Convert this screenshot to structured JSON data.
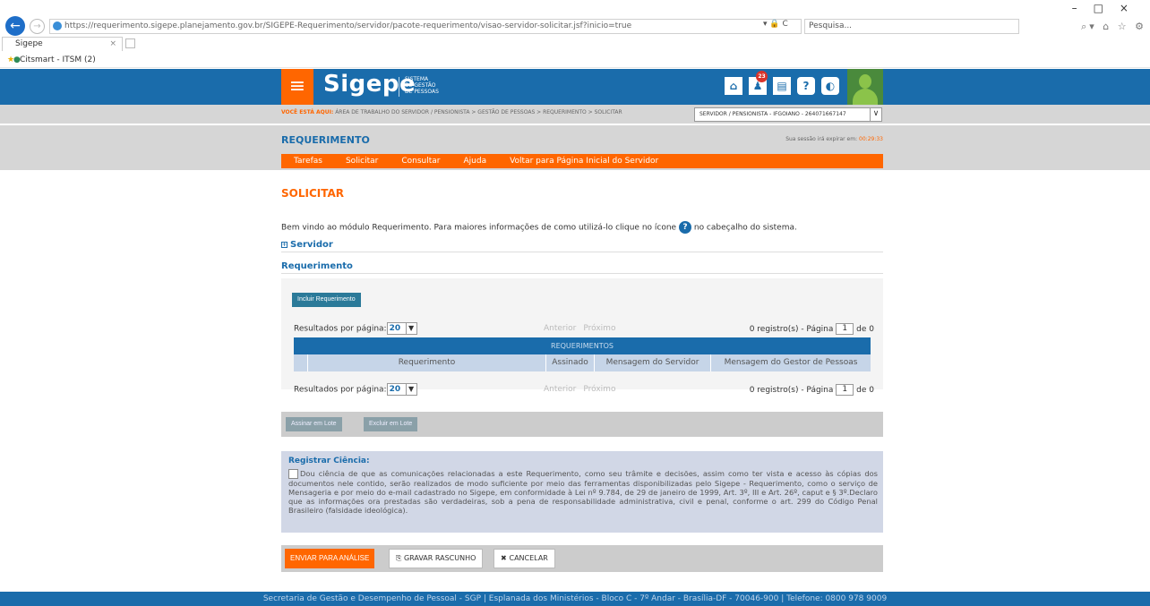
{
  "browser": {
    "url": "https://requerimento.sigepe.planejamento.gov.br/SIGEPE-Requerimento/servidor/pacote-requerimento/visao-servidor-solicitar.jsf?inicio=true",
    "search_placeholder": "Pesquisa...",
    "tab_title": "Sigepe",
    "favorite_label": "Citsmart - ITSM (2)",
    "url_tools": "▾ 🔒 C",
    "window_controls": "–□×",
    "right_icons": "⌕▾ ⌂ ☆ ⚙"
  },
  "header": {
    "logo": "Sigepe",
    "logo_sub_1": "SISTEMA",
    "logo_sub_2": "DE GESTÃO",
    "logo_sub_3": "DE PESSOAS",
    "notification_count": "23",
    "menu_icon": "≡",
    "home_icon": "⌂",
    "bell_icon": "♟",
    "book_icon": "▤",
    "help_icon": "?",
    "contrast_icon": "◐"
  },
  "breadcrumb": {
    "here_label": "VOCÊ ESTÁ AQUI:",
    "path": "ÁREA DE TRABALHO DO SERVIDOR / PENSIONISTA  >  GESTÃO DE PESSOAS  >  REQUERIMENTO  >  SOLICITAR",
    "profile": "SERVIDOR / PENSIONISTA - IFGOIANO - 264071667147",
    "profile_arrow": "∨"
  },
  "title_bar": {
    "title": "REQUERIMENTO",
    "session_label": "Sua sessão irá expirar em:",
    "session_time": "00:29:33"
  },
  "nav": {
    "items": [
      "Tarefas",
      "Solicitar",
      "Consultar",
      "Ajuda",
      "Voltar para Página Inicial do Servidor"
    ]
  },
  "main": {
    "heading": "SOLICITAR",
    "welcome_before": "Bem vindo ao módulo Requerimento. Para maiores informações de como utilizá-lo clique no ícone",
    "welcome_after": "no cabeçalho do sistema.",
    "servidor_label": "Servidor",
    "requerimento_label": "Requerimento",
    "incluir_button": "Incluir Requerimento",
    "per_page_label": "Resultados por página:",
    "per_page_value": "20",
    "prev": "Anterior",
    "next": "Próximo",
    "records_label": "0 registro(s) - Página",
    "page_value": "1",
    "of_label": "de 0",
    "table_title": "REQUERIMENTOS",
    "columns": [
      "Requerimento",
      "Assinado",
      "Mensagem do Servidor",
      "Mensagem do Gestor de Pessoas"
    ],
    "assinar_lote": "Assinar em Lote",
    "excluir_lote": "Excluir em Lote",
    "ciencia_title": "Registrar Ciência:",
    "ciencia_text": "Dou ciência de que as comunicações relacionadas a este Requerimento, como seu trâmite e decisões, assim como ter vista e acesso às cópias dos documentos nele contido, serão realizados de modo suficiente por meio das ferramentas disponibilizadas pelo Sigepe - Requerimento, como o serviço de Mensageria e por meio do e-mail cadastrado no Sigepe, em conformidade à Lei nº 9.784, de 29 de janeiro de 1999, Art. 3º, III e Art. 26º, caput e § 3º.Declaro que as informações ora prestadas são verdadeiras, sob a pena de responsabilidade administrativa, civil e penal, conforme o art. 299 do Código Penal Brasileiro (falsidade ideológica).",
    "enviar_button": "ENVIAR PARA ANÁLISE",
    "rascunho_button": "GRAVAR RASCUNHO",
    "cancelar_button": "CANCELAR"
  },
  "footer": {
    "text": "Secretaria de Gestão e Desempenho de Pessoal - SGP | Esplanada dos Ministérios - Bloco C - 7º Andar - Brasília-DF - 70046-900 | Telefone: 0800 978 9009"
  },
  "colors": {
    "brand_blue": "#1a6cab",
    "brand_orange": "#ff6600",
    "teal_button": "#2b7a99"
  }
}
